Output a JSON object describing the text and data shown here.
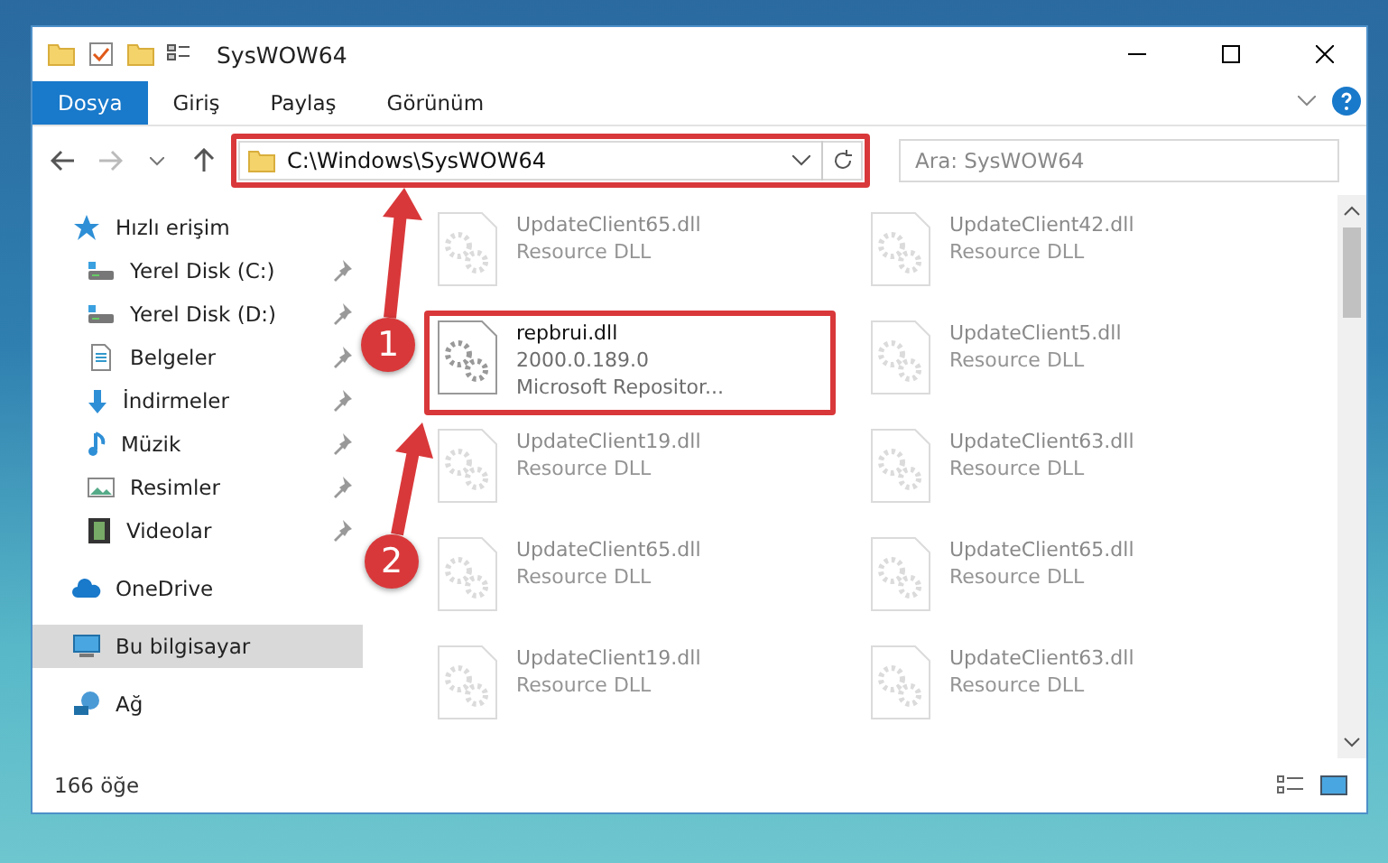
{
  "window": {
    "title": "SysWOW64"
  },
  "ribbon_tabs": [
    {
      "label": "Dosya",
      "selected": true
    },
    {
      "label": "Giriş",
      "selected": false
    },
    {
      "label": "Paylaş",
      "selected": false
    },
    {
      "label": "Görünüm",
      "selected": false
    }
  ],
  "address": {
    "path": "C:\\Windows\\SysWOW64",
    "annotated": true
  },
  "search": {
    "placeholder": "Ara: SysWOW64"
  },
  "sidebar": {
    "items": [
      {
        "label": "Hızlı erişim",
        "kind": "star",
        "selected": false,
        "children": [
          {
            "label": "Yerel Disk (C:)",
            "kind": "drive",
            "pinned": true,
            "selected": false
          },
          {
            "label": "Yerel Disk (D:)",
            "kind": "drive",
            "pinned": true,
            "selected": false
          },
          {
            "label": "Belgeler",
            "kind": "document",
            "pinned": true,
            "selected": false
          },
          {
            "label": "İndirmeler",
            "kind": "download",
            "pinned": true,
            "selected": false
          },
          {
            "label": "Müzik",
            "kind": "music",
            "pinned": true,
            "selected": false
          },
          {
            "label": "Resimler",
            "kind": "picture",
            "pinned": true,
            "selected": false
          },
          {
            "label": "Videolar",
            "kind": "video",
            "pinned": true,
            "selected": false
          }
        ]
      },
      {
        "label": "OneDrive",
        "kind": "cloud",
        "selected": false
      },
      {
        "label": "Bu bilgisayar",
        "kind": "computer",
        "selected": true
      },
      {
        "label": "Ağ",
        "kind": "network",
        "selected": false
      }
    ]
  },
  "files": [
    {
      "name": "UpdateClient65.dll",
      "lines": [
        "Resource DLL"
      ],
      "selected": false,
      "annotated": false
    },
    {
      "name": "UpdateClient42.dll",
      "lines": [
        "Resource DLL"
      ],
      "selected": false,
      "annotated": false
    },
    {
      "name": "repbrui.dll",
      "lines": [
        "2000.0.189.0",
        "Microsoft Repositor..."
      ],
      "selected": true,
      "annotated": true
    },
    {
      "name": "UpdateClient5.dll",
      "lines": [
        "Resource DLL"
      ],
      "selected": false,
      "annotated": false
    },
    {
      "name": "UpdateClient19.dll",
      "lines": [
        "Resource DLL"
      ],
      "selected": false,
      "annotated": false
    },
    {
      "name": "UpdateClient63.dll",
      "lines": [
        "Resource DLL"
      ],
      "selected": false,
      "annotated": false
    },
    {
      "name": "UpdateClient65.dll",
      "lines": [
        "Resource DLL"
      ],
      "selected": false,
      "annotated": false
    },
    {
      "name": "UpdateClient65.dll",
      "lines": [
        "Resource DLL"
      ],
      "selected": false,
      "annotated": false
    },
    {
      "name": "UpdateClient19.dll",
      "lines": [
        "Resource DLL"
      ],
      "selected": false,
      "annotated": false
    },
    {
      "name": "UpdateClient63.dll",
      "lines": [
        "Resource DLL"
      ],
      "selected": false,
      "annotated": false
    }
  ],
  "status_bar": {
    "count": "166 öğe"
  },
  "callouts": [
    {
      "number": "1"
    },
    {
      "number": "2"
    }
  ]
}
